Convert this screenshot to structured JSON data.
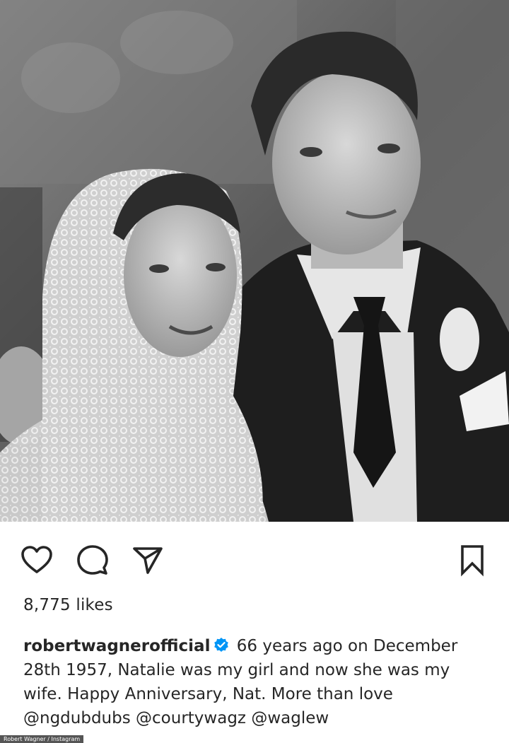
{
  "post": {
    "image_alt": "Black and white wedding photo of a bride in a lace veil and a groom in a dark suit with a boutonniere",
    "likes_text": "8,775 likes",
    "username": "robertwagnerofficial",
    "caption_text": "66 years ago on December 28th 1957, Natalie was my girl and now she was my wife. Happy Anniversary, Nat. More than love",
    "mentions": [
      "@ngdubdubs",
      "@courtywagz",
      "@waglew"
    ],
    "credit": "Robert Wagner / Instagram"
  },
  "icons": {
    "like": "heart-outline-icon",
    "comment": "speech-bubble-icon",
    "share": "paper-plane-icon",
    "save": "bookmark-outline-icon",
    "verified": "verified-badge-icon"
  },
  "colors": {
    "text": "#262626",
    "verified": "#0095f6"
  }
}
